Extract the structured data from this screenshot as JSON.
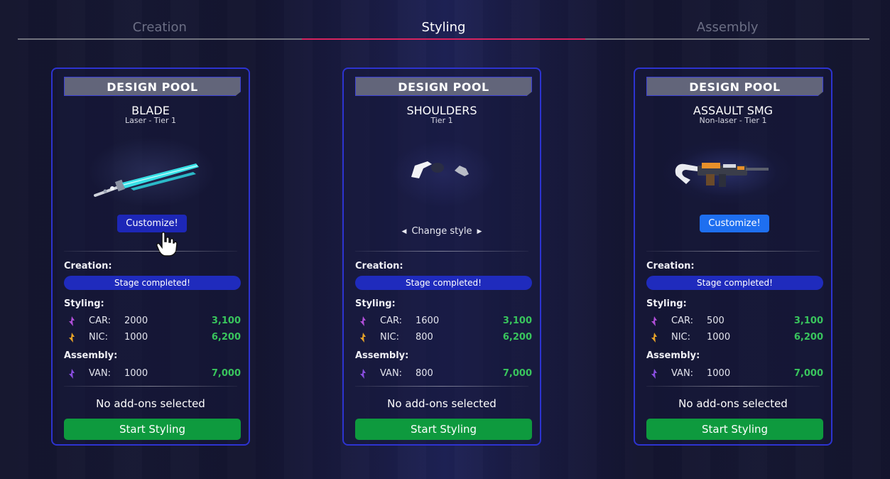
{
  "tabs": [
    {
      "label": "Creation",
      "active": false
    },
    {
      "label": "Styling",
      "active": true
    },
    {
      "label": "Assembly",
      "active": false
    }
  ],
  "colors": {
    "accent_tab": "#d6245f",
    "card_border": "#2d33d0",
    "stage_bar": "#1f2bbd",
    "start_button": "#0e9a3e",
    "total_value": "#39c55d",
    "customize_hover": "#1d27b7",
    "customize_default": "#1e6ff0"
  },
  "cards": [
    {
      "pool_label": "DESIGN POOL",
      "name": "BLADE",
      "subtitle": "Laser - Tier 1",
      "art_icon": "laser-blade-icon",
      "customize_label": "Customize!",
      "creation_label": "Creation:",
      "stage_status": "Stage completed!",
      "styling_label": "Styling:",
      "styling_resources": [
        {
          "icon": "car-resource-icon",
          "name": "CAR:",
          "value": "2000",
          "total": "3,100"
        },
        {
          "icon": "nic-resource-icon",
          "name": "NIC:",
          "value": "1000",
          "total": "6,200"
        }
      ],
      "assembly_label": "Assembly:",
      "assembly_resources": [
        {
          "icon": "van-resource-icon",
          "name": "VAN:",
          "value": "1000",
          "total": "7,000"
        }
      ],
      "addons_text": "No add-ons selected",
      "start_label": "Start Styling"
    },
    {
      "pool_label": "DESIGN POOL",
      "name": "SHOULDERS",
      "subtitle": "Tier 1",
      "art_icon": "shoulder-armor-icon",
      "change_style_label": "Change style",
      "creation_label": "Creation:",
      "stage_status": "Stage completed!",
      "styling_label": "Styling:",
      "styling_resources": [
        {
          "icon": "car-resource-icon",
          "name": "CAR:",
          "value": "1600",
          "total": "3,100"
        },
        {
          "icon": "nic-resource-icon",
          "name": "NIC:",
          "value": "800",
          "total": "6,200"
        }
      ],
      "assembly_label": "Assembly:",
      "assembly_resources": [
        {
          "icon": "van-resource-icon",
          "name": "VAN:",
          "value": "800",
          "total": "7,000"
        }
      ],
      "addons_text": "No add-ons selected",
      "start_label": "Start Styling"
    },
    {
      "pool_label": "DESIGN POOL",
      "name": "ASSAULT SMG",
      "subtitle": "Non-laser - Tier 1",
      "art_icon": "assault-smg-icon",
      "customize_label": "Customize!",
      "creation_label": "Creation:",
      "stage_status": "Stage completed!",
      "styling_label": "Styling:",
      "styling_resources": [
        {
          "icon": "car-resource-icon",
          "name": "CAR:",
          "value": "500",
          "total": "3,100"
        },
        {
          "icon": "nic-resource-icon",
          "name": "NIC:",
          "value": "1000",
          "total": "6,200"
        }
      ],
      "assembly_label": "Assembly:",
      "assembly_resources": [
        {
          "icon": "van-resource-icon",
          "name": "VAN:",
          "value": "1000",
          "total": "7,000"
        }
      ],
      "addons_text": "No add-ons selected",
      "start_label": "Start Styling"
    }
  ]
}
